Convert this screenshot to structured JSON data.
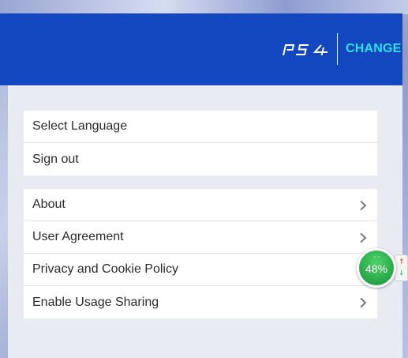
{
  "header": {
    "platform_logo_text": "PS4",
    "change_label": "CHANGE"
  },
  "account_menu": {
    "items": [
      {
        "label": "Select Language"
      },
      {
        "label": "Sign out"
      }
    ]
  },
  "info_menu": {
    "items": [
      {
        "label": "About",
        "icon": "chevron-right-icon"
      },
      {
        "label": "User Agreement",
        "icon": "chevron-right-icon"
      },
      {
        "label": "Privacy and Cookie Policy",
        "icon": "chevron-right-icon"
      },
      {
        "label": "Enable Usage Sharing",
        "icon": "chevron-right-icon"
      }
    ]
  },
  "speed_widget": {
    "percent_label": "48%",
    "up_arrow": "↑",
    "down_arrow": "↓"
  },
  "colors": {
    "header_bg": "#1347c0",
    "accent_cyan": "#2ee0e8",
    "panel_bg": "#e9ebf2",
    "widget_green": "#2eb04e"
  }
}
